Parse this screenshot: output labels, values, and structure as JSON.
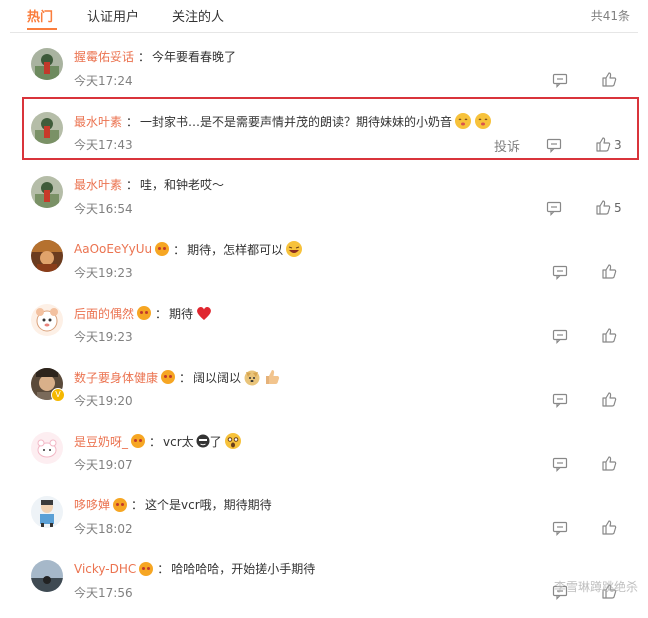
{
  "tabs": [
    {
      "label": "热门"
    },
    {
      "label": "认证用户"
    },
    {
      "label": "关注的人"
    }
  ],
  "total_label": "共41条",
  "comments": [
    {
      "user": "握霉佑妥话",
      "sep": "：",
      "text": "今年要看春晚了",
      "time": "今天17:24",
      "likes": "",
      "badge": false
    },
    {
      "user": "最水叶素",
      "sep": "：",
      "text": "一封家书…是不是需要声情并茂的朗读？期待妹妹的小奶音",
      "time": "今天17:43",
      "likes": "3",
      "badge": false,
      "report": "投诉"
    },
    {
      "user": "最水叶素",
      "sep": "：",
      "text": "哇，和钟老哎～",
      "time": "今天16:54",
      "likes": "5",
      "badge": false
    },
    {
      "user": "AaOoEeYyUu",
      "sep": "：",
      "text": "期待，怎样都可以",
      "time": "今天19:23",
      "likes": "",
      "badge": true
    },
    {
      "user": "后面的偶然",
      "sep": "：",
      "text": "期待",
      "time": "今天19:23",
      "likes": "",
      "badge": true
    },
    {
      "user": "数子要身体健康",
      "sep": "：",
      "text": "阔以阔以",
      "time": "今天19:20",
      "likes": "",
      "badge": true
    },
    {
      "user": "是豆奶呀_",
      "sep": "：",
      "text": "vcr太",
      "text2": "了",
      "time": "今天19:07",
      "likes": "",
      "badge": true
    },
    {
      "user": "哆哆婵",
      "sep": "：",
      "text": "这个是vcr哦，期待期待",
      "time": "今天18:02",
      "likes": "",
      "badge": true
    },
    {
      "user": "Vicky-DHC",
      "sep": "：",
      "text": "哈哈哈哈，开始搓小手期待",
      "time": "今天17:56",
      "likes": "",
      "badge": true
    }
  ],
  "watermark": "李雪琳蹲跳绝杀",
  "icons": {
    "reply": "comment-icon",
    "like": "thumbs-up-icon",
    "accent": "#fa7d3c",
    "name_color": "#eb7350",
    "highlight": "#d9343b"
  }
}
